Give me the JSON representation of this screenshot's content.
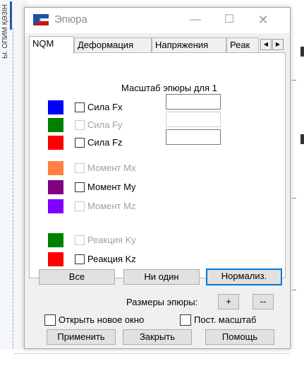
{
  "background": {
    "left_text": "Ы. ОПИМ ҚӘЗІН",
    "accent": "#2855a8"
  },
  "window": {
    "title": "Эпюра",
    "minimize_icon": "minimize-icon",
    "maximize_icon": "maximize-icon",
    "close_icon": "close-icon"
  },
  "tabs": [
    {
      "label": "NQM",
      "active": true
    },
    {
      "label": "Деформация",
      "active": false
    },
    {
      "label": "Напряжения",
      "active": false
    },
    {
      "label": "Реак",
      "active": false
    }
  ],
  "tab_scroll": {
    "left": "◀",
    "right": "▶"
  },
  "panel": {
    "scale_label": "Масштаб эпюры для 1",
    "rows": [
      {
        "label": "Сила Fx",
        "color": "#0000ff",
        "enabled": true,
        "checked": false,
        "scale_input": true,
        "scale_value": ""
      },
      {
        "label": "Сила Fy",
        "color": "#008000",
        "enabled": false,
        "checked": false,
        "scale_input": true,
        "scale_value": ""
      },
      {
        "label": "Сила Fz",
        "color": "#ff0000",
        "enabled": true,
        "checked": false,
        "scale_input": true,
        "scale_value": ""
      },
      {
        "label": "Момент Mx",
        "color": "#ff8040",
        "enabled": false,
        "checked": false
      },
      {
        "label": "Момент My",
        "color": "#800080",
        "enabled": true,
        "checked": false
      },
      {
        "label": "Момент Mz",
        "color": "#8000ff",
        "enabled": false,
        "checked": false
      },
      {
        "label": "Реакция Ky",
        "color": "#008000",
        "enabled": false,
        "checked": false
      },
      {
        "label": "Реакция Kz",
        "color": "#ff0000",
        "enabled": true,
        "checked": false
      }
    ],
    "buttons": {
      "all": "Все",
      "none": "Ни один",
      "normalize": "Нормализ."
    }
  },
  "size": {
    "label": "Размеры эпюры:",
    "plus": "+",
    "minus": "--"
  },
  "options": {
    "new_window": "Открыть новое окно",
    "const_scale": "Пост. масштаб"
  },
  "footer": {
    "apply": "Применить",
    "close": "Закрыть",
    "help": "Помощь"
  }
}
